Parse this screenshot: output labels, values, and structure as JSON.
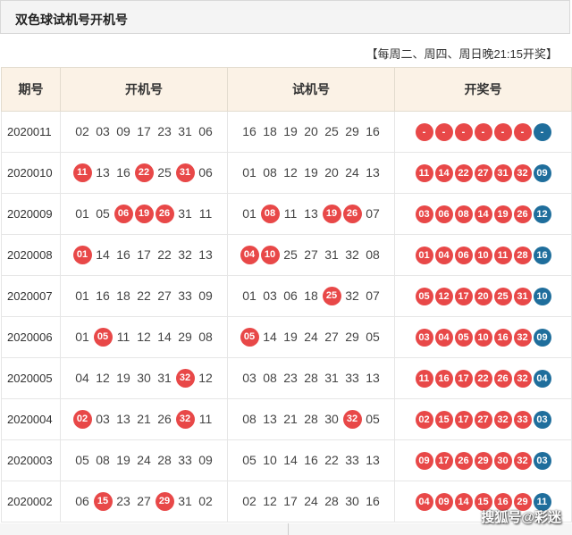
{
  "header": {
    "title": "双色球试机号开机号"
  },
  "schedule": "【每周二、周四、周日晚21:15开奖】",
  "columns": [
    "期号",
    "开机号",
    "试机号",
    "开奖号"
  ],
  "rows": [
    {
      "period": "2020011",
      "open": [
        "02",
        "03",
        "09",
        "17",
        "23",
        "31",
        "06"
      ],
      "open_hits": [],
      "test": [
        "16",
        "18",
        "19",
        "20",
        "25",
        "29",
        "16"
      ],
      "test_hits": [],
      "draw": [
        "-",
        "-",
        "-",
        "-",
        "-",
        "-",
        "-"
      ]
    },
    {
      "period": "2020010",
      "open": [
        "11",
        "13",
        "16",
        "22",
        "25",
        "31",
        "06"
      ],
      "open_hits": [
        0,
        3,
        5
      ],
      "test": [
        "01",
        "08",
        "12",
        "19",
        "20",
        "24",
        "13"
      ],
      "test_hits": [],
      "draw": [
        "11",
        "14",
        "22",
        "27",
        "31",
        "32",
        "09"
      ]
    },
    {
      "period": "2020009",
      "open": [
        "01",
        "05",
        "06",
        "19",
        "26",
        "31",
        "11"
      ],
      "open_hits": [
        2,
        3,
        4
      ],
      "test": [
        "01",
        "08",
        "11",
        "13",
        "19",
        "26",
        "07"
      ],
      "test_hits": [
        1,
        4,
        5
      ],
      "draw": [
        "03",
        "06",
        "08",
        "14",
        "19",
        "26",
        "12"
      ]
    },
    {
      "period": "2020008",
      "open": [
        "01",
        "14",
        "16",
        "17",
        "22",
        "32",
        "13"
      ],
      "open_hits": [
        0
      ],
      "test": [
        "04",
        "10",
        "25",
        "27",
        "31",
        "32",
        "08"
      ],
      "test_hits": [
        0,
        1
      ],
      "draw": [
        "01",
        "04",
        "06",
        "10",
        "11",
        "28",
        "16"
      ]
    },
    {
      "period": "2020007",
      "open": [
        "01",
        "16",
        "18",
        "22",
        "27",
        "33",
        "09"
      ],
      "open_hits": [],
      "test": [
        "01",
        "03",
        "06",
        "18",
        "25",
        "32",
        "07"
      ],
      "test_hits": [
        4
      ],
      "draw": [
        "05",
        "12",
        "17",
        "20",
        "25",
        "31",
        "10"
      ]
    },
    {
      "period": "2020006",
      "open": [
        "01",
        "05",
        "11",
        "12",
        "14",
        "29",
        "08"
      ],
      "open_hits": [
        1
      ],
      "test": [
        "05",
        "14",
        "19",
        "24",
        "27",
        "29",
        "05"
      ],
      "test_hits": [
        0
      ],
      "draw": [
        "03",
        "04",
        "05",
        "10",
        "16",
        "32",
        "09"
      ]
    },
    {
      "period": "2020005",
      "open": [
        "04",
        "12",
        "19",
        "30",
        "31",
        "32",
        "12"
      ],
      "open_hits": [
        5
      ],
      "test": [
        "03",
        "08",
        "23",
        "28",
        "31",
        "33",
        "13"
      ],
      "test_hits": [],
      "draw": [
        "11",
        "16",
        "17",
        "22",
        "26",
        "32",
        "04"
      ]
    },
    {
      "period": "2020004",
      "open": [
        "02",
        "03",
        "13",
        "21",
        "26",
        "32",
        "11"
      ],
      "open_hits": [
        0,
        5
      ],
      "test": [
        "08",
        "13",
        "21",
        "28",
        "30",
        "32",
        "05"
      ],
      "test_hits": [
        5
      ],
      "draw": [
        "02",
        "15",
        "17",
        "27",
        "32",
        "33",
        "03"
      ]
    },
    {
      "period": "2020003",
      "open": [
        "05",
        "08",
        "19",
        "24",
        "28",
        "33",
        "09"
      ],
      "open_hits": [],
      "test": [
        "05",
        "10",
        "14",
        "16",
        "22",
        "33",
        "13"
      ],
      "test_hits": [],
      "draw": [
        "09",
        "17",
        "26",
        "29",
        "30",
        "32",
        "03"
      ]
    },
    {
      "period": "2020002",
      "open": [
        "06",
        "15",
        "23",
        "27",
        "29",
        "31",
        "02"
      ],
      "open_hits": [
        1,
        4
      ],
      "test": [
        "02",
        "12",
        "17",
        "24",
        "28",
        "30",
        "16"
      ],
      "test_hits": [],
      "draw": [
        "04",
        "09",
        "14",
        "15",
        "16",
        "29",
        "11"
      ]
    }
  ],
  "watermark": "搜狐号@彩迷",
  "colors": {
    "red_ball": "#e84848",
    "blue_ball": "#1f6e9c",
    "header_bg": "#fbf2e6"
  }
}
